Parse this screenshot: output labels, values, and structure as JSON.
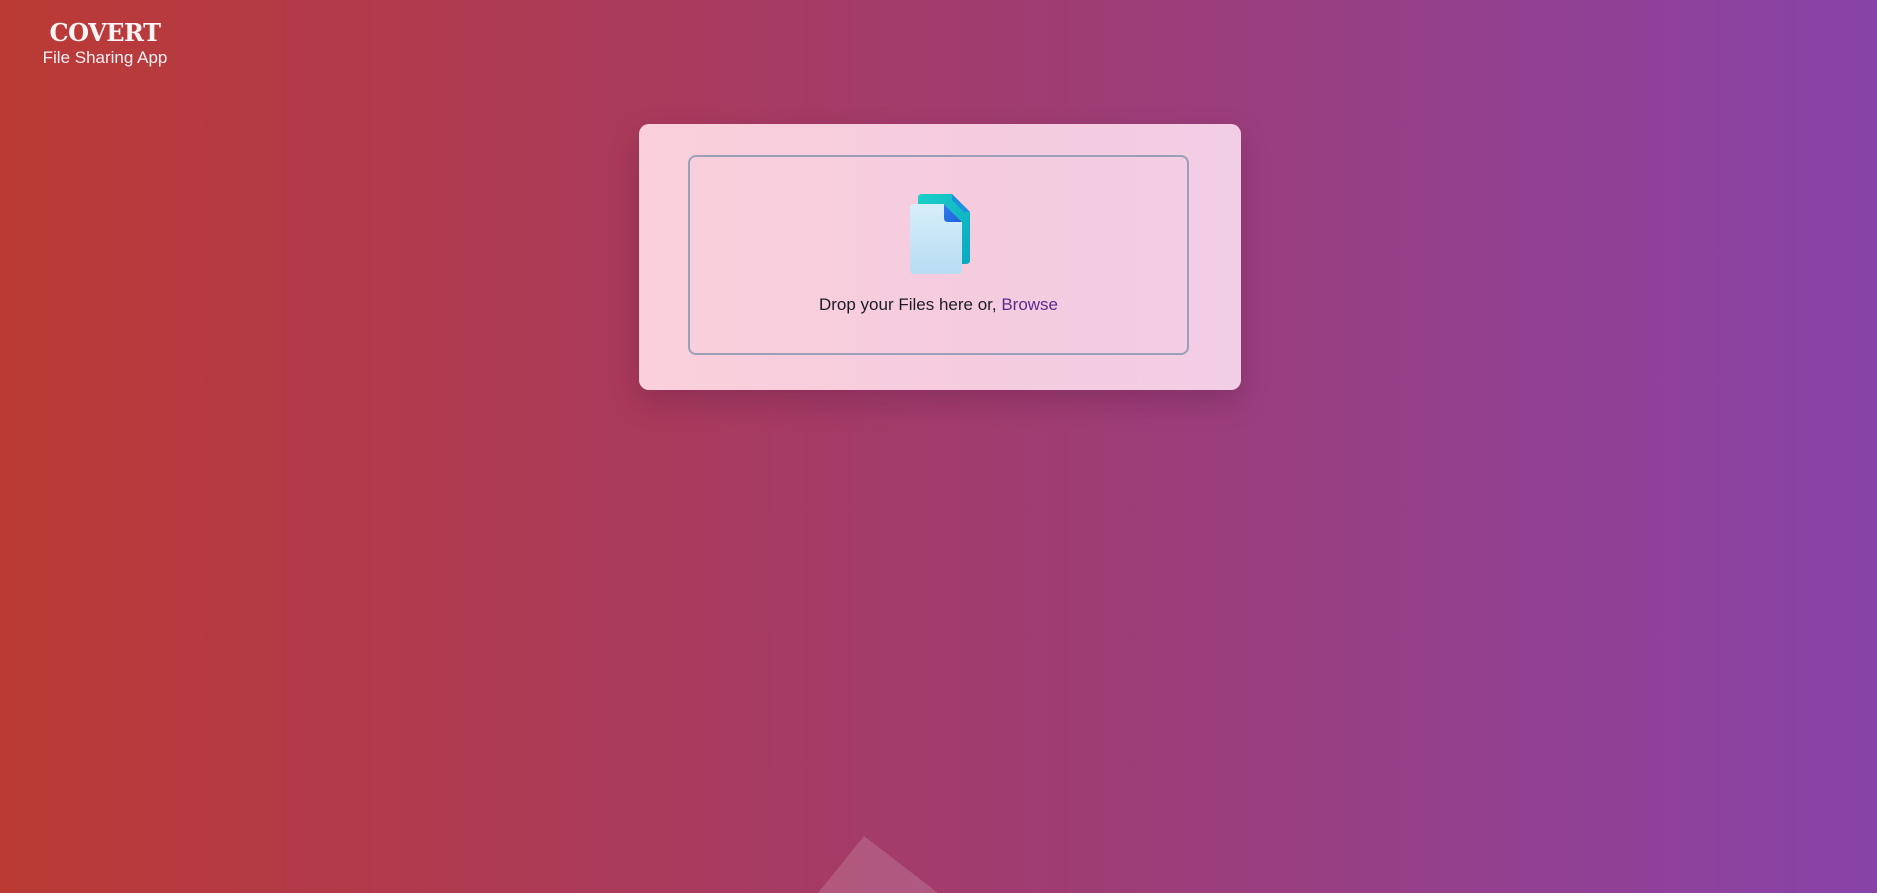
{
  "brand": {
    "title": "COVERT",
    "subtitle": "File Sharing App"
  },
  "upload": {
    "icon": "file-icon",
    "prompt": "Drop your Files here or, ",
    "browse_label": "Browse"
  },
  "colors": {
    "gradient_start": "#bb3a34",
    "gradient_end": "#8843a8",
    "card_background": "#f7cddf",
    "drop_zone_border": "#9aa0b8",
    "link": "#5b2a8c"
  }
}
